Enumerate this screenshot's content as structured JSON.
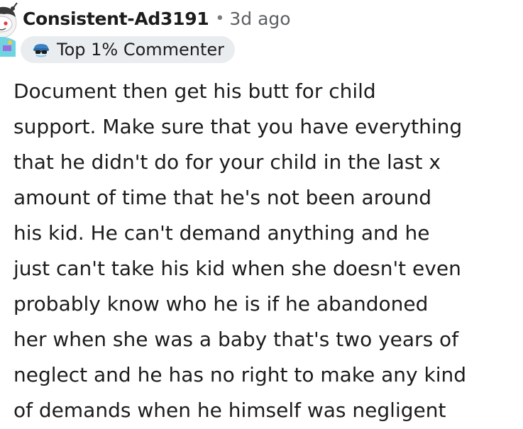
{
  "comment": {
    "author": "Consistent-Ad3191",
    "separator": "•",
    "timestamp": "3d ago",
    "flair": {
      "label": "Top 1% Commenter",
      "icon": "commenter-badge-icon"
    },
    "avatar_icon": "snoo-avatar-icon",
    "body_lines": [
      "Document then get his butt for child",
      "support. Make sure that you have everything",
      "that he didn't do for your child in the last x",
      "amount of time that he's not been around",
      "his kid. He can't demand anything and he",
      "just can't take his kid when she doesn't even",
      "probably know who he is if he abandoned",
      "her when she was a baby that's two years of",
      "neglect and he has no right to make any kind",
      "of demands when he himself was negligent"
    ]
  },
  "colors": {
    "text": "#1c1c1c",
    "meta": "#5c5f62",
    "flair_bg": "#eaedef"
  }
}
